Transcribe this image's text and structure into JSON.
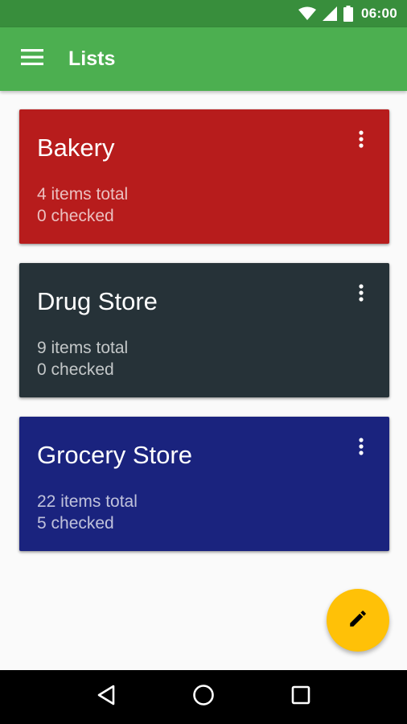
{
  "status_bar": {
    "time": "06:00",
    "icons": [
      "wifi-icon",
      "signal-icon",
      "battery-icon"
    ],
    "color": "#388e3c"
  },
  "app_bar": {
    "title": "Lists",
    "menu_icon": "menu-icon",
    "color": "#4caf50"
  },
  "lists": [
    {
      "name": "Bakery",
      "total": "4 items total",
      "checked": "0 checked",
      "color": "#b71c1c"
    },
    {
      "name": "Drug Store",
      "total": "9 items total",
      "checked": "0 checked",
      "color": "#263238"
    },
    {
      "name": "Grocery Store",
      "total": "22 items total",
      "checked": "5 checked",
      "color": "#1a237e"
    }
  ],
  "fab": {
    "icon": "edit-icon",
    "color": "#ffc107"
  },
  "nav_bar": {
    "icons": [
      "back-icon",
      "home-icon",
      "recents-icon"
    ]
  }
}
